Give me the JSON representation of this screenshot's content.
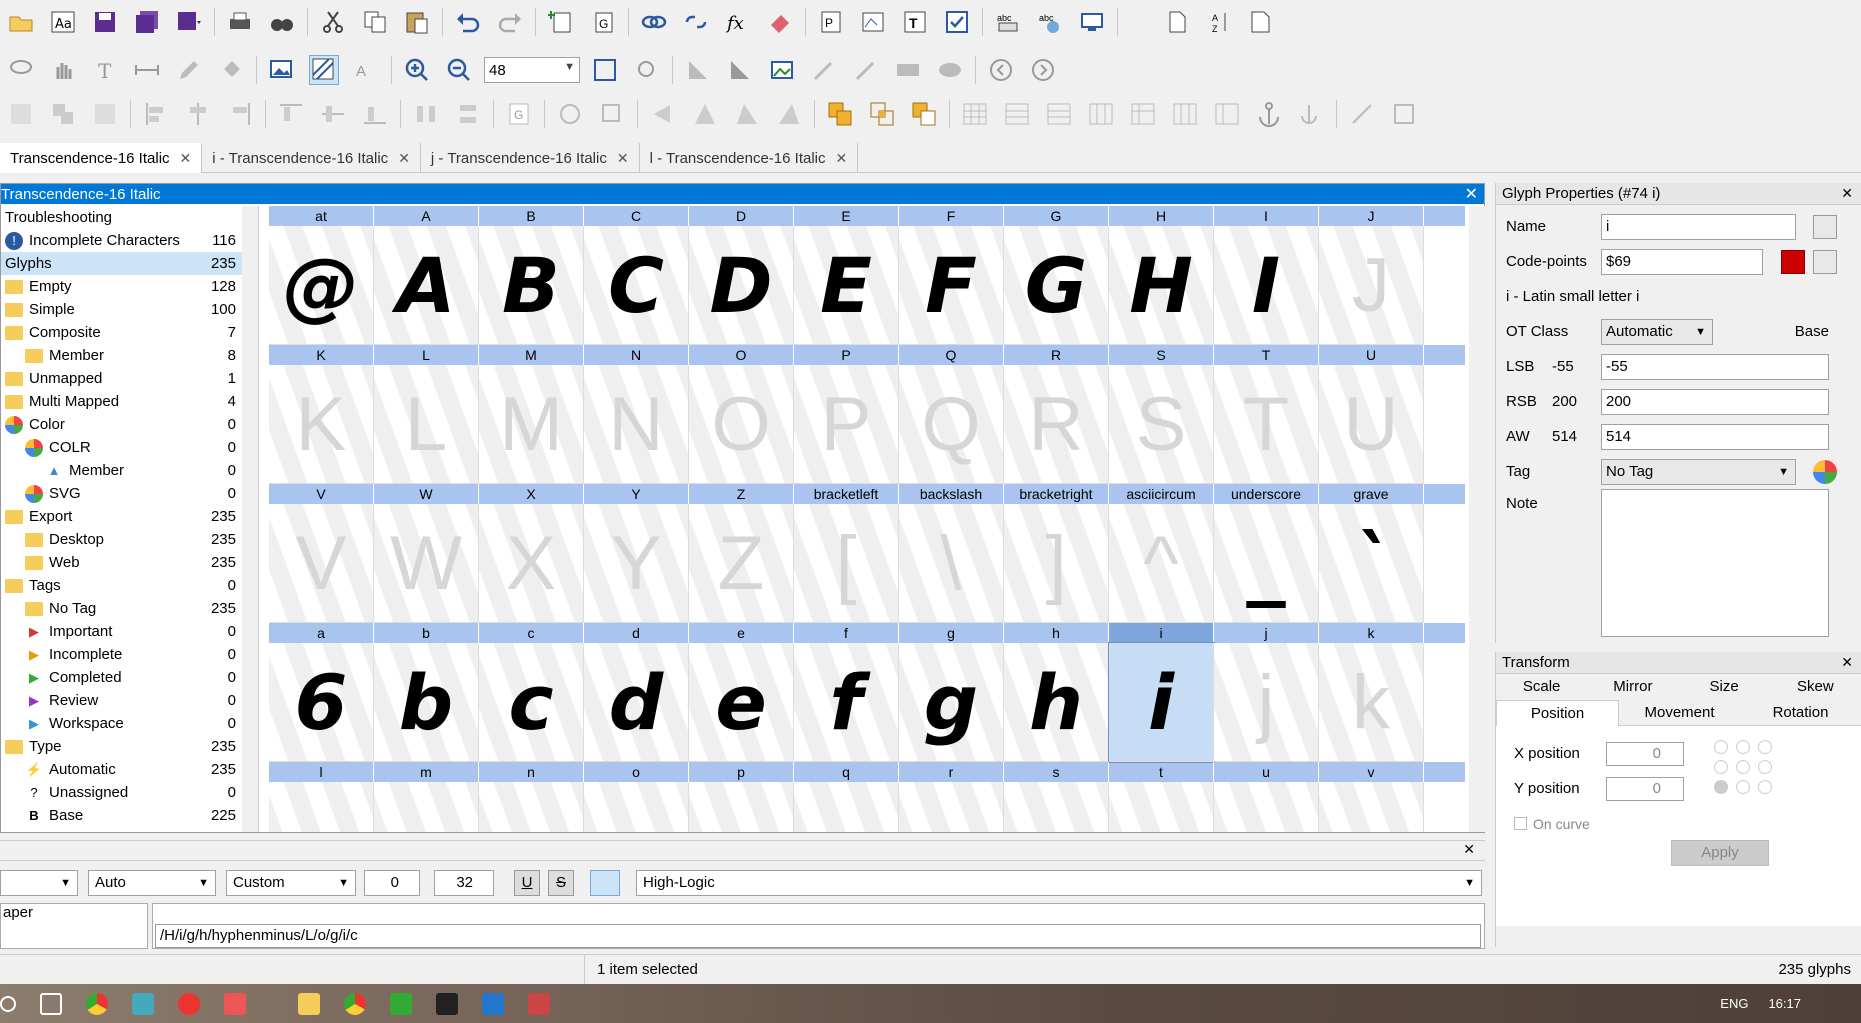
{
  "toolbar": {
    "zoom_value": "48"
  },
  "tabs": [
    {
      "label": "Transcendence-16 Italic",
      "active": true
    },
    {
      "label": "i - Transcendence-16 Italic",
      "active": false
    },
    {
      "label": "j - Transcendence-16 Italic",
      "active": false
    },
    {
      "label": "l - Transcendence-16 Italic",
      "active": false
    }
  ],
  "font_window": {
    "title": "Transcendence-16 Italic",
    "close": "✕"
  },
  "tree": [
    {
      "label": "Troubleshooting",
      "count": "",
      "indent": 0,
      "icon": "none"
    },
    {
      "label": "Incomplete Characters",
      "count": "116",
      "indent": 0,
      "icon": "info"
    },
    {
      "label": "Glyphs",
      "count": "235",
      "indent": 0,
      "icon": "none",
      "selected": true
    },
    {
      "label": "Empty",
      "count": "128",
      "indent": 0,
      "icon": "folder"
    },
    {
      "label": "Simple",
      "count": "100",
      "indent": 0,
      "icon": "folder"
    },
    {
      "label": "Composite",
      "count": "7",
      "indent": 0,
      "icon": "folder"
    },
    {
      "label": "Member",
      "count": "8",
      "indent": 1,
      "icon": "folder"
    },
    {
      "label": "Unmapped",
      "count": "1",
      "indent": 0,
      "icon": "folder"
    },
    {
      "label": "Multi Mapped",
      "count": "4",
      "indent": 0,
      "icon": "folder"
    },
    {
      "label": "Color",
      "count": "0",
      "indent": 0,
      "icon": "color"
    },
    {
      "label": "COLR",
      "count": "0",
      "indent": 1,
      "icon": "color"
    },
    {
      "label": "Member",
      "count": "0",
      "indent": 2,
      "icon": "triangle"
    },
    {
      "label": "SVG",
      "count": "0",
      "indent": 1,
      "icon": "color"
    },
    {
      "label": "Export",
      "count": "235",
      "indent": 0,
      "icon": "folder"
    },
    {
      "label": "Desktop",
      "count": "235",
      "indent": 1,
      "icon": "folder"
    },
    {
      "label": "Web",
      "count": "235",
      "indent": 1,
      "icon": "folder"
    },
    {
      "label": "Tags",
      "count": "0",
      "indent": 0,
      "icon": "folder"
    },
    {
      "label": "No Tag",
      "count": "235",
      "indent": 1,
      "icon": "folder"
    },
    {
      "label": "Important",
      "count": "0",
      "indent": 1,
      "icon": "flag-red"
    },
    {
      "label": "Incomplete",
      "count": "0",
      "indent": 1,
      "icon": "flag-orange"
    },
    {
      "label": "Completed",
      "count": "0",
      "indent": 1,
      "icon": "flag-green"
    },
    {
      "label": "Review",
      "count": "0",
      "indent": 1,
      "icon": "flag-purple"
    },
    {
      "label": "Workspace",
      "count": "0",
      "indent": 1,
      "icon": "flag-blue"
    },
    {
      "label": "Type",
      "count": "235",
      "indent": 0,
      "icon": "folder"
    },
    {
      "label": "Automatic",
      "count": "235",
      "indent": 1,
      "icon": "bolt"
    },
    {
      "label": "Unassigned",
      "count": "0",
      "indent": 1,
      "icon": "question"
    },
    {
      "label": "Base",
      "count": "225",
      "indent": 1,
      "icon": "B"
    }
  ],
  "glyph_rows": [
    {
      "names": [
        "at",
        "A",
        "B",
        "C",
        "D",
        "E",
        "F",
        "G",
        "H",
        "I",
        "J"
      ],
      "chars": [
        "@",
        "A",
        "B",
        "C",
        "D",
        "E",
        "F",
        "G",
        "H",
        "I",
        "J"
      ],
      "filled": [
        true,
        true,
        true,
        true,
        true,
        true,
        true,
        true,
        true,
        true,
        false
      ]
    },
    {
      "names": [
        "K",
        "L",
        "M",
        "N",
        "O",
        "P",
        "Q",
        "R",
        "S",
        "T",
        "U"
      ],
      "chars": [
        "K",
        "L",
        "M",
        "N",
        "O",
        "P",
        "Q",
        "R",
        "S",
        "T",
        "U"
      ],
      "filled": [
        false,
        false,
        false,
        false,
        false,
        false,
        false,
        false,
        false,
        false,
        false
      ]
    },
    {
      "names": [
        "V",
        "W",
        "X",
        "Y",
        "Z",
        "bracketleft",
        "backslash",
        "bracketright",
        "asciicircum",
        "underscore",
        "grave"
      ],
      "chars": [
        "V",
        "W",
        "X",
        "Y",
        "Z",
        "[",
        "\\",
        "]",
        "^",
        "_",
        "`"
      ],
      "filled": [
        false,
        false,
        false,
        false,
        false,
        false,
        false,
        false,
        false,
        true,
        true
      ]
    },
    {
      "names": [
        "a",
        "b",
        "c",
        "d",
        "e",
        "f",
        "g",
        "h",
        "i",
        "j",
        "k"
      ],
      "chars": [
        "6",
        "b",
        "c",
        "d",
        "e",
        "f",
        "g",
        "h",
        "i",
        "j",
        "k"
      ],
      "filled": [
        true,
        true,
        true,
        true,
        true,
        true,
        true,
        true,
        true,
        false,
        false
      ],
      "selected_index": 8
    },
    {
      "names": [
        "l",
        "m",
        "n",
        "o",
        "p",
        "q",
        "r",
        "s",
        "t",
        "u",
        "v"
      ],
      "chars": [
        "",
        "",
        "",
        "",
        "",
        "",
        "",
        "",
        "",
        "",
        ""
      ],
      "filled": [
        false,
        false,
        false,
        false,
        false,
        false,
        false,
        false,
        false,
        false,
        false
      ]
    }
  ],
  "props": {
    "title": "Glyph Properties (#74 i)",
    "name_label": "Name",
    "name_value": "i",
    "codepoints_label": "Code-points",
    "codepoints_value": "$69",
    "description": "i - Latin small letter i",
    "otclass_label": "OT Class",
    "otclass_value": "Automatic",
    "otclass_result": "Base",
    "lsb_label": "LSB",
    "lsb_current": "-55",
    "lsb_value": "-55",
    "rsb_label": "RSB",
    "rsb_current": "200",
    "rsb_value": "200",
    "aw_label": "AW",
    "aw_current": "514",
    "aw_value": "514",
    "tag_label": "Tag",
    "tag_value": "No Tag",
    "note_label": "Note"
  },
  "transform": {
    "title": "Transform",
    "tabs_row1": [
      "Scale",
      "Mirror",
      "Size",
      "Skew"
    ],
    "tabs_row2": [
      "Position",
      "Movement",
      "Rotation"
    ],
    "x_label": "X position",
    "x_value": "0",
    "y_label": "Y position",
    "y_value": "0",
    "oncurve_label": "On curve",
    "apply_label": "Apply"
  },
  "bottom": {
    "mode_value": "Auto",
    "size_value": "Custom",
    "spin1_value": "0",
    "spin2_value": "32",
    "font_value": "High-Logic",
    "list_item": "aper",
    "text_value": "/H/i/g/h/hyphenminus/L/o/g/i/c"
  },
  "status": {
    "selection": "1 item selected",
    "glyph_count": "235 glyphs"
  },
  "taskbar": {
    "lang": "ENG",
    "time": "16:17"
  },
  "colors": {
    "accent": "#0078d7",
    "header_row": "#a9c5ef",
    "selected_cell": "#c7dcf5"
  }
}
